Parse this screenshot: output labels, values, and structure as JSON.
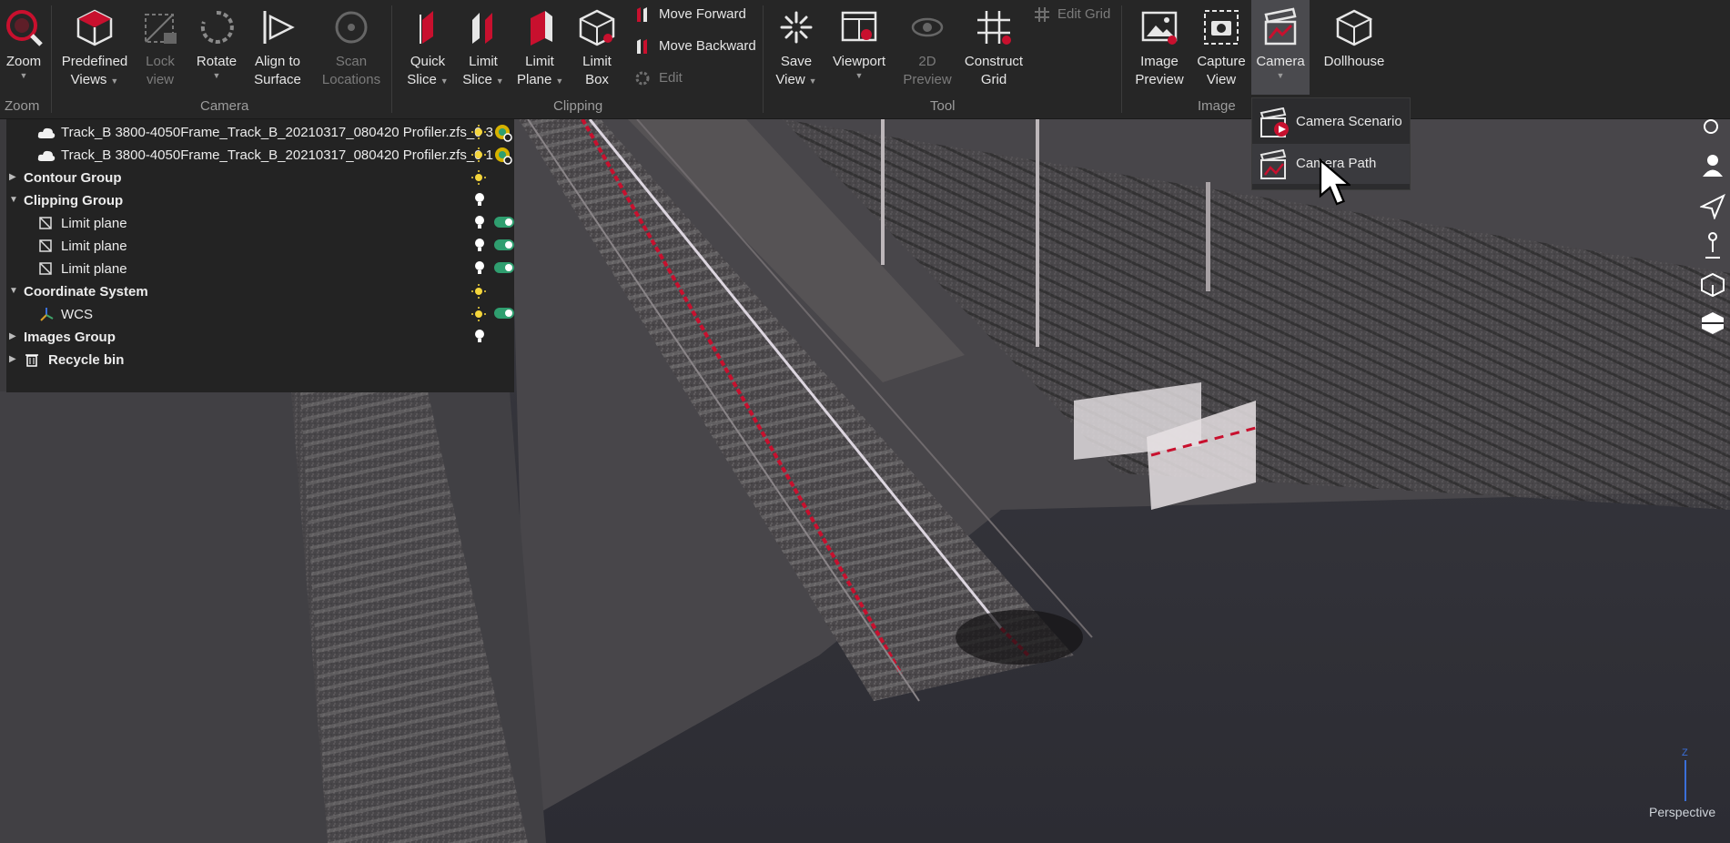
{
  "ribbon": {
    "zoom": {
      "label": "Zoom",
      "group": "Zoom"
    },
    "camera_group": {
      "title": "Camera",
      "predefined_views": {
        "line1": "Predefined",
        "line2": "Views"
      },
      "lock_view": {
        "line1": "Lock",
        "line2": "view"
      },
      "rotate": {
        "label": "Rotate"
      },
      "align_to_surface": {
        "line1": "Align to",
        "line2": "Surface"
      },
      "scan_locations": {
        "line1": "Scan",
        "line2": "Locations"
      }
    },
    "clipping_group": {
      "title": "Clipping",
      "quick_slice": {
        "line1": "Quick",
        "line2": "Slice"
      },
      "limit_slice": {
        "line1": "Limit",
        "line2": "Slice"
      },
      "limit_plane": {
        "line1": "Limit",
        "line2": "Plane"
      },
      "limit_box": {
        "line1": "Limit",
        "line2": "Box"
      },
      "move_forward": "Move Forward",
      "move_backward": "Move Backward",
      "edit": "Edit"
    },
    "tool_group": {
      "title": "Tool",
      "save_view": {
        "line1": "Save",
        "line2": "View"
      },
      "viewport": {
        "label": "Viewport"
      },
      "preview_2d": {
        "line1": "2D",
        "line2": "Preview"
      },
      "construct_grid": {
        "line1": "Construct",
        "line2": "Grid"
      },
      "edit_grid": "Edit Grid"
    },
    "image_group": {
      "title": "Image",
      "image_preview": {
        "line1": "Image",
        "line2": "Preview"
      },
      "capture_view": {
        "line1": "Capture",
        "line2": "View"
      },
      "camera": {
        "label": "Camera"
      },
      "dollhouse": {
        "label": "Dollhouse"
      }
    }
  },
  "camera_menu": {
    "items": [
      {
        "label": "Camera Scenario"
      },
      {
        "label": "Camera Path"
      }
    ]
  },
  "tree": {
    "rows": [
      {
        "label": "Track_B 3800-4050Frame_Track_B_20210317_080420 Profiler.zfs_0 3"
      },
      {
        "label": "Track_B 3800-4050Frame_Track_B_20210317_080420 Profiler.zfs_0 1"
      },
      {
        "label": "Contour Group"
      },
      {
        "label": "Clipping Group"
      },
      {
        "label": "Limit plane"
      },
      {
        "label": "Limit plane"
      },
      {
        "label": "Limit plane"
      },
      {
        "label": "Coordinate System"
      },
      {
        "label": "WCS"
      },
      {
        "label": "Images Group"
      },
      {
        "label": "Recycle bin"
      }
    ]
  },
  "viewport": {
    "projection": "Perspective"
  },
  "colors": {
    "accent": "#c8102e",
    "ribbon_bg": "#262626",
    "panel_bg": "#232323",
    "toggle_on": "#2f9e6f",
    "bulb_on": "#f5d63c"
  }
}
